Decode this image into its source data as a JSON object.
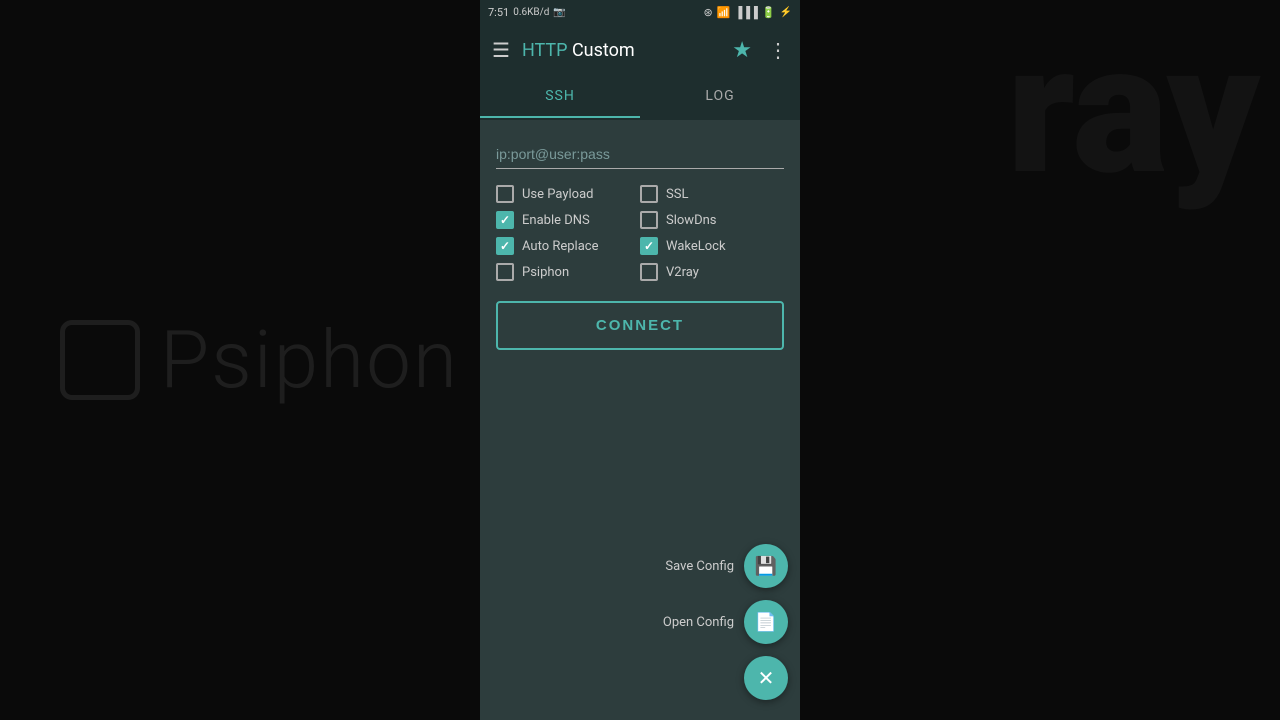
{
  "background": {
    "psiphon_text": "Psiphon",
    "ray_text": "ray"
  },
  "status_bar": {
    "time": "7:51",
    "data_speed": "0.6KB/d",
    "battery_icon": "🔋"
  },
  "app_bar": {
    "menu_icon": "☰",
    "title_http": "HTTP",
    "title_rest": " Custom",
    "star_icon": "★",
    "more_icon": "⋮"
  },
  "tabs": [
    {
      "label": "SSH",
      "active": true
    },
    {
      "label": "LOG",
      "active": false
    }
  ],
  "input": {
    "placeholder": "ip:port@user:pass",
    "value": ""
  },
  "options": [
    {
      "label": "Use Payload",
      "checked": false,
      "col": 1
    },
    {
      "label": "SSL",
      "checked": false,
      "col": 2
    },
    {
      "label": "Enable DNS",
      "checked": true,
      "col": 1
    },
    {
      "label": "SlowDns",
      "checked": false,
      "col": 2
    },
    {
      "label": "Auto Replace",
      "checked": true,
      "col": 1
    },
    {
      "label": "WakeLock",
      "checked": true,
      "col": 2
    },
    {
      "label": "Psiphon",
      "checked": false,
      "col": 1
    },
    {
      "label": "V2ray",
      "checked": false,
      "col": 2
    }
  ],
  "connect_button": {
    "label": "CONNECT"
  },
  "fab_buttons": [
    {
      "label": "Save Config",
      "icon": "💾",
      "id": "save-config"
    },
    {
      "label": "Open Config",
      "icon": "📄",
      "id": "open-config"
    }
  ],
  "fab_close": {
    "icon": "✕",
    "id": "close-fab"
  }
}
